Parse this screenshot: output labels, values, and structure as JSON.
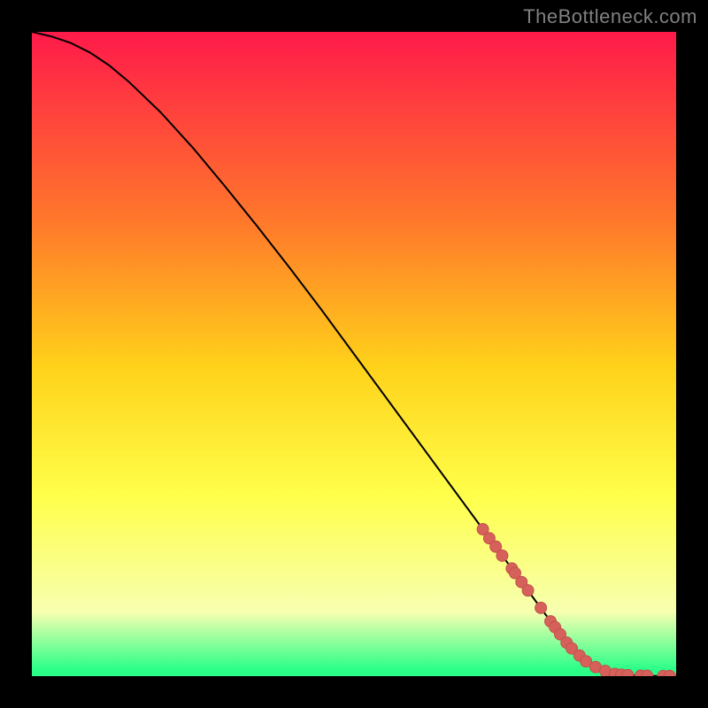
{
  "watermark": "TheBottleneck.com",
  "colors": {
    "bg": "#000000",
    "grad_top": "#ff1a4a",
    "grad_mid_upper": "#ff7a2a",
    "grad_mid": "#ffd21a",
    "grad_mid_lower": "#ffff4a",
    "grad_low": "#f7ffb0",
    "grad_base": "#2aff88",
    "curve": "#000000",
    "marker_fill": "#d6605a",
    "marker_stroke": "#c2524c"
  },
  "chart_data": {
    "type": "line",
    "title": "",
    "xlabel": "",
    "ylabel": "",
    "xlim": [
      0,
      100
    ],
    "ylim": [
      0,
      100
    ],
    "series": [
      {
        "name": "bottleneck-curve",
        "x": [
          0,
          3,
          6,
          9,
          12,
          15,
          20,
          25,
          30,
          35,
          40,
          45,
          50,
          55,
          60,
          65,
          70,
          75,
          80,
          83,
          85,
          88,
          90,
          92,
          94,
          96,
          98,
          100
        ],
        "y": [
          100,
          99.3,
          98.3,
          96.8,
          94.8,
          92.3,
          87.5,
          82.0,
          76.0,
          69.8,
          63.4,
          56.8,
          50.0,
          43.2,
          36.4,
          29.6,
          22.8,
          16.0,
          9.2,
          5.2,
          3.2,
          1.2,
          0.4,
          0.15,
          0.08,
          0.04,
          0.02,
          0.01
        ]
      }
    ],
    "markers": {
      "name": "highlighted-points",
      "x": [
        70,
        71,
        72,
        73,
        74.5,
        75,
        76,
        77,
        79,
        80.5,
        81.2,
        82,
        83,
        83.8,
        85,
        86,
        87.5,
        89,
        90.5,
        91.5,
        92.5,
        94.5,
        95.5,
        98,
        99
      ],
      "y": [
        22.8,
        21.4,
        20.1,
        18.7,
        16.7,
        16.0,
        14.6,
        13.3,
        10.6,
        8.5,
        7.6,
        6.5,
        5.2,
        4.3,
        3.2,
        2.3,
        1.4,
        0.8,
        0.35,
        0.22,
        0.16,
        0.07,
        0.05,
        0.02,
        0.015
      ]
    }
  }
}
